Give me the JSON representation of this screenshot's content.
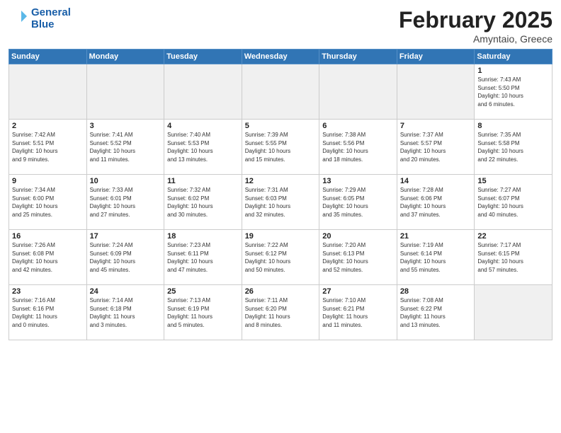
{
  "header": {
    "logo_line1": "General",
    "logo_line2": "Blue",
    "title": "February 2025",
    "subtitle": "Amyntaio, Greece"
  },
  "weekdays": [
    "Sunday",
    "Monday",
    "Tuesday",
    "Wednesday",
    "Thursday",
    "Friday",
    "Saturday"
  ],
  "weeks": [
    [
      {
        "day": "",
        "info": ""
      },
      {
        "day": "",
        "info": ""
      },
      {
        "day": "",
        "info": ""
      },
      {
        "day": "",
        "info": ""
      },
      {
        "day": "",
        "info": ""
      },
      {
        "day": "",
        "info": ""
      },
      {
        "day": "1",
        "info": "Sunrise: 7:43 AM\nSunset: 5:50 PM\nDaylight: 10 hours\nand 6 minutes."
      }
    ],
    [
      {
        "day": "2",
        "info": "Sunrise: 7:42 AM\nSunset: 5:51 PM\nDaylight: 10 hours\nand 9 minutes."
      },
      {
        "day": "3",
        "info": "Sunrise: 7:41 AM\nSunset: 5:52 PM\nDaylight: 10 hours\nand 11 minutes."
      },
      {
        "day": "4",
        "info": "Sunrise: 7:40 AM\nSunset: 5:53 PM\nDaylight: 10 hours\nand 13 minutes."
      },
      {
        "day": "5",
        "info": "Sunrise: 7:39 AM\nSunset: 5:55 PM\nDaylight: 10 hours\nand 15 minutes."
      },
      {
        "day": "6",
        "info": "Sunrise: 7:38 AM\nSunset: 5:56 PM\nDaylight: 10 hours\nand 18 minutes."
      },
      {
        "day": "7",
        "info": "Sunrise: 7:37 AM\nSunset: 5:57 PM\nDaylight: 10 hours\nand 20 minutes."
      },
      {
        "day": "8",
        "info": "Sunrise: 7:35 AM\nSunset: 5:58 PM\nDaylight: 10 hours\nand 22 minutes."
      }
    ],
    [
      {
        "day": "9",
        "info": "Sunrise: 7:34 AM\nSunset: 6:00 PM\nDaylight: 10 hours\nand 25 minutes."
      },
      {
        "day": "10",
        "info": "Sunrise: 7:33 AM\nSunset: 6:01 PM\nDaylight: 10 hours\nand 27 minutes."
      },
      {
        "day": "11",
        "info": "Sunrise: 7:32 AM\nSunset: 6:02 PM\nDaylight: 10 hours\nand 30 minutes."
      },
      {
        "day": "12",
        "info": "Sunrise: 7:31 AM\nSunset: 6:03 PM\nDaylight: 10 hours\nand 32 minutes."
      },
      {
        "day": "13",
        "info": "Sunrise: 7:29 AM\nSunset: 6:05 PM\nDaylight: 10 hours\nand 35 minutes."
      },
      {
        "day": "14",
        "info": "Sunrise: 7:28 AM\nSunset: 6:06 PM\nDaylight: 10 hours\nand 37 minutes."
      },
      {
        "day": "15",
        "info": "Sunrise: 7:27 AM\nSunset: 6:07 PM\nDaylight: 10 hours\nand 40 minutes."
      }
    ],
    [
      {
        "day": "16",
        "info": "Sunrise: 7:26 AM\nSunset: 6:08 PM\nDaylight: 10 hours\nand 42 minutes."
      },
      {
        "day": "17",
        "info": "Sunrise: 7:24 AM\nSunset: 6:09 PM\nDaylight: 10 hours\nand 45 minutes."
      },
      {
        "day": "18",
        "info": "Sunrise: 7:23 AM\nSunset: 6:11 PM\nDaylight: 10 hours\nand 47 minutes."
      },
      {
        "day": "19",
        "info": "Sunrise: 7:22 AM\nSunset: 6:12 PM\nDaylight: 10 hours\nand 50 minutes."
      },
      {
        "day": "20",
        "info": "Sunrise: 7:20 AM\nSunset: 6:13 PM\nDaylight: 10 hours\nand 52 minutes."
      },
      {
        "day": "21",
        "info": "Sunrise: 7:19 AM\nSunset: 6:14 PM\nDaylight: 10 hours\nand 55 minutes."
      },
      {
        "day": "22",
        "info": "Sunrise: 7:17 AM\nSunset: 6:15 PM\nDaylight: 10 hours\nand 57 minutes."
      }
    ],
    [
      {
        "day": "23",
        "info": "Sunrise: 7:16 AM\nSunset: 6:16 PM\nDaylight: 11 hours\nand 0 minutes."
      },
      {
        "day": "24",
        "info": "Sunrise: 7:14 AM\nSunset: 6:18 PM\nDaylight: 11 hours\nand 3 minutes."
      },
      {
        "day": "25",
        "info": "Sunrise: 7:13 AM\nSunset: 6:19 PM\nDaylight: 11 hours\nand 5 minutes."
      },
      {
        "day": "26",
        "info": "Sunrise: 7:11 AM\nSunset: 6:20 PM\nDaylight: 11 hours\nand 8 minutes."
      },
      {
        "day": "27",
        "info": "Sunrise: 7:10 AM\nSunset: 6:21 PM\nDaylight: 11 hours\nand 11 minutes."
      },
      {
        "day": "28",
        "info": "Sunrise: 7:08 AM\nSunset: 6:22 PM\nDaylight: 11 hours\nand 13 minutes."
      },
      {
        "day": "",
        "info": ""
      }
    ]
  ]
}
